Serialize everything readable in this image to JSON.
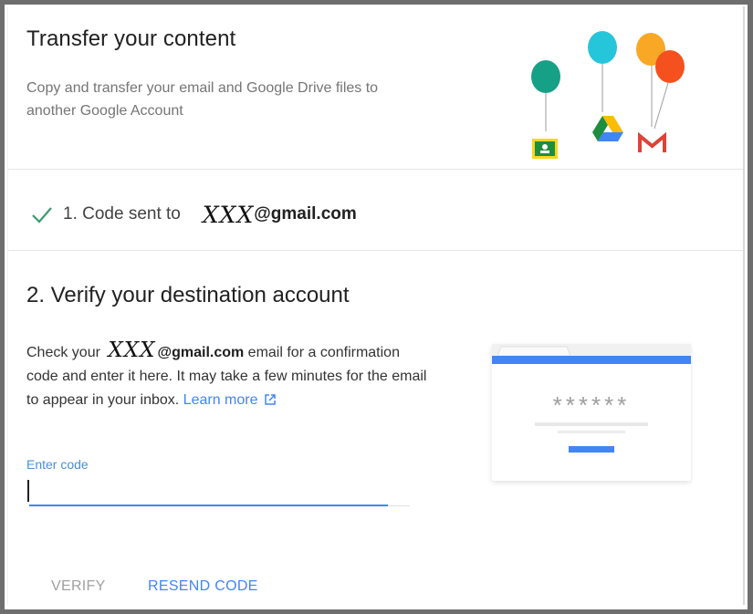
{
  "header": {
    "title": "Transfer your content",
    "subtitle": "Copy and transfer your email and Google Drive files to another Google Account",
    "illustration_icons": [
      "classroom-icon",
      "drive-icon",
      "gmail-icon"
    ],
    "balloon_colors": [
      "#16a085",
      "#26c6da",
      "#f9a825",
      "#f4511e"
    ]
  },
  "step1": {
    "label": "1. Code sent to",
    "email_redacted": "XXX",
    "email_domain": "@gmail.com",
    "status_icon": "check-icon",
    "status_color": "#3d9970"
  },
  "step2": {
    "title": "2. Verify your destination account",
    "desc_prefix": "Check your",
    "email_redacted": "XXX",
    "email_domain": "@gmail.com",
    "desc_suffix": " email for a confirmation code and enter it here. It may take a few minutes for the email to appear in your inbox. ",
    "learn_more": "Learn more",
    "code_label": "Enter code",
    "code_value": "",
    "illustration_mask": "******"
  },
  "actions": {
    "verify": "VERIFY",
    "resend": "RESEND CODE"
  },
  "colors": {
    "accent": "#4285f4",
    "disabled": "#a0a0a0",
    "frame": "#6e6e6e"
  }
}
